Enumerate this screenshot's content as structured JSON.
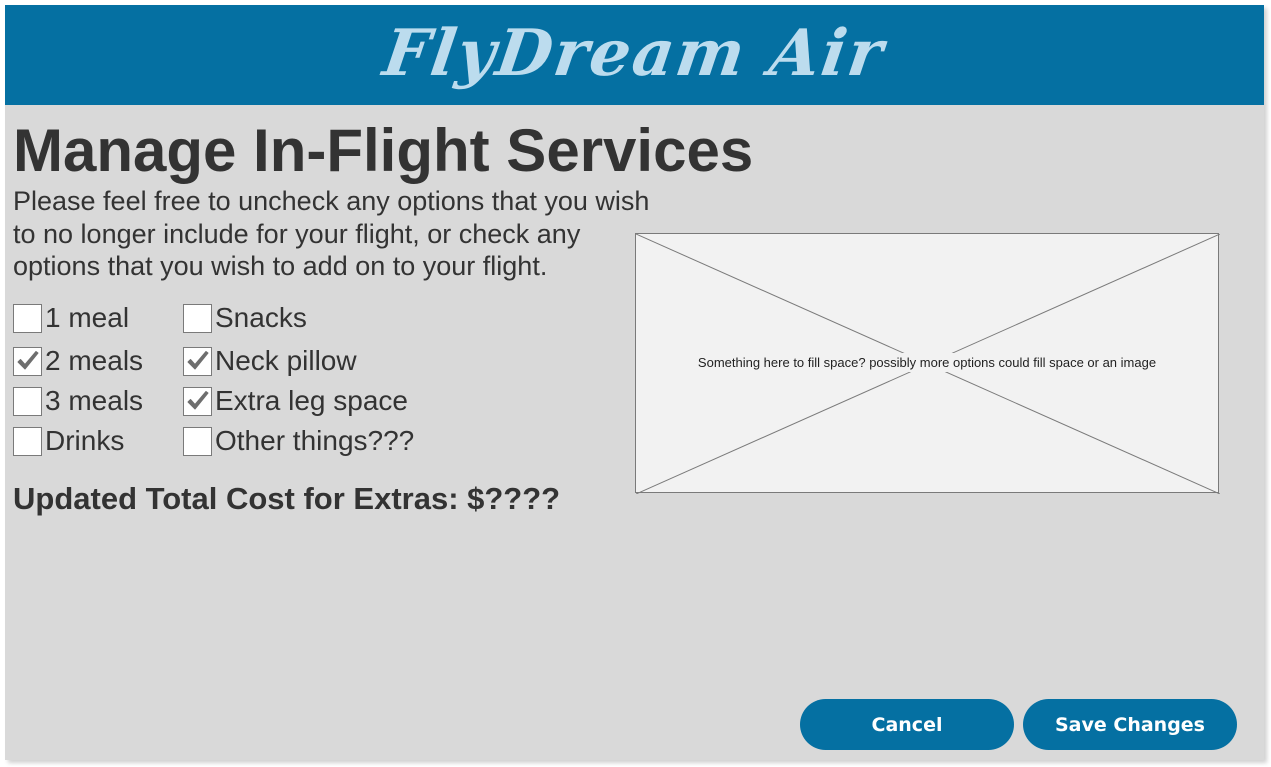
{
  "header": {
    "brand": "FlyDream Air",
    "brand_color": "#bcdcee",
    "background_color": "#0570a2"
  },
  "main": {
    "title": "Manage In-Flight Services",
    "intro_lines": [
      "Please feel free to uncheck any options that you wish",
      "to no longer include for your flight, or check any",
      "options that you wish to add on to your flight."
    ],
    "options": [
      {
        "label": "1 meal",
        "checked": false
      },
      {
        "label": "2 meals",
        "checked": true
      },
      {
        "label": "3 meals",
        "checked": false
      },
      {
        "label": "Drinks",
        "checked": false
      },
      {
        "label": "Snacks",
        "checked": false
      },
      {
        "label": "Neck pillow",
        "checked": true
      },
      {
        "label": "Extra leg space",
        "checked": true
      },
      {
        "label": "Other things???",
        "checked": false
      }
    ],
    "total_cost": "Updated Total Cost for Extras: $????"
  },
  "placeholder": {
    "caption": "Something here to fill space? possibly more options could fill space or an image"
  },
  "buttons": {
    "cancel": "Cancel",
    "save": "Save Changes"
  },
  "colors": {
    "accent": "#0570a2",
    "panel": "#d9d9d9",
    "text": "#333333",
    "check": "#6e6e6e"
  }
}
